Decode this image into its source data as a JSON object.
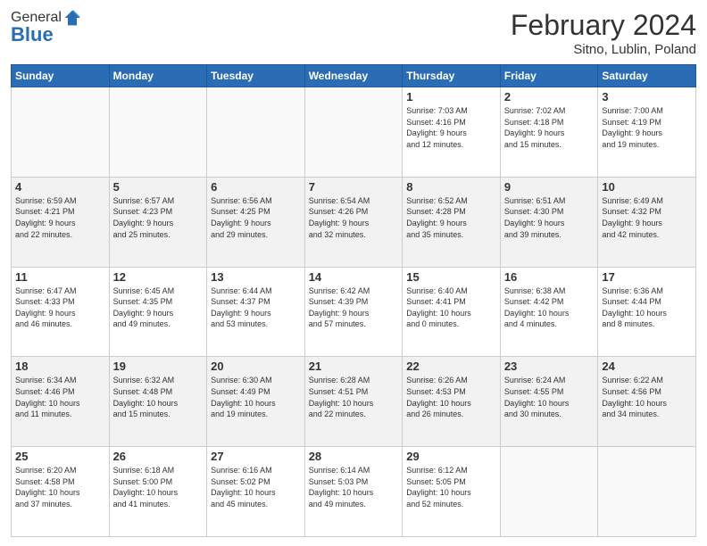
{
  "header": {
    "logo_general": "General",
    "logo_blue": "Blue",
    "month_title": "February 2024",
    "location": "Sitno, Lublin, Poland"
  },
  "days_of_week": [
    "Sunday",
    "Monday",
    "Tuesday",
    "Wednesday",
    "Thursday",
    "Friday",
    "Saturday"
  ],
  "weeks": [
    {
      "shade": false,
      "days": [
        {
          "num": "",
          "empty": true
        },
        {
          "num": "",
          "empty": true
        },
        {
          "num": "",
          "empty": true
        },
        {
          "num": "",
          "empty": true
        },
        {
          "num": "1",
          "info": "Sunrise: 7:03 AM\nSunset: 4:16 PM\nDaylight: 9 hours\nand 12 minutes."
        },
        {
          "num": "2",
          "info": "Sunrise: 7:02 AM\nSunset: 4:18 PM\nDaylight: 9 hours\nand 15 minutes."
        },
        {
          "num": "3",
          "info": "Sunrise: 7:00 AM\nSunset: 4:19 PM\nDaylight: 9 hours\nand 19 minutes."
        }
      ]
    },
    {
      "shade": true,
      "days": [
        {
          "num": "4",
          "info": "Sunrise: 6:59 AM\nSunset: 4:21 PM\nDaylight: 9 hours\nand 22 minutes."
        },
        {
          "num": "5",
          "info": "Sunrise: 6:57 AM\nSunset: 4:23 PM\nDaylight: 9 hours\nand 25 minutes."
        },
        {
          "num": "6",
          "info": "Sunrise: 6:56 AM\nSunset: 4:25 PM\nDaylight: 9 hours\nand 29 minutes."
        },
        {
          "num": "7",
          "info": "Sunrise: 6:54 AM\nSunset: 4:26 PM\nDaylight: 9 hours\nand 32 minutes."
        },
        {
          "num": "8",
          "info": "Sunrise: 6:52 AM\nSunset: 4:28 PM\nDaylight: 9 hours\nand 35 minutes."
        },
        {
          "num": "9",
          "info": "Sunrise: 6:51 AM\nSunset: 4:30 PM\nDaylight: 9 hours\nand 39 minutes."
        },
        {
          "num": "10",
          "info": "Sunrise: 6:49 AM\nSunset: 4:32 PM\nDaylight: 9 hours\nand 42 minutes."
        }
      ]
    },
    {
      "shade": false,
      "days": [
        {
          "num": "11",
          "info": "Sunrise: 6:47 AM\nSunset: 4:33 PM\nDaylight: 9 hours\nand 46 minutes."
        },
        {
          "num": "12",
          "info": "Sunrise: 6:45 AM\nSunset: 4:35 PM\nDaylight: 9 hours\nand 49 minutes."
        },
        {
          "num": "13",
          "info": "Sunrise: 6:44 AM\nSunset: 4:37 PM\nDaylight: 9 hours\nand 53 minutes."
        },
        {
          "num": "14",
          "info": "Sunrise: 6:42 AM\nSunset: 4:39 PM\nDaylight: 9 hours\nand 57 minutes."
        },
        {
          "num": "15",
          "info": "Sunrise: 6:40 AM\nSunset: 4:41 PM\nDaylight: 10 hours\nand 0 minutes."
        },
        {
          "num": "16",
          "info": "Sunrise: 6:38 AM\nSunset: 4:42 PM\nDaylight: 10 hours\nand 4 minutes."
        },
        {
          "num": "17",
          "info": "Sunrise: 6:36 AM\nSunset: 4:44 PM\nDaylight: 10 hours\nand 8 minutes."
        }
      ]
    },
    {
      "shade": true,
      "days": [
        {
          "num": "18",
          "info": "Sunrise: 6:34 AM\nSunset: 4:46 PM\nDaylight: 10 hours\nand 11 minutes."
        },
        {
          "num": "19",
          "info": "Sunrise: 6:32 AM\nSunset: 4:48 PM\nDaylight: 10 hours\nand 15 minutes."
        },
        {
          "num": "20",
          "info": "Sunrise: 6:30 AM\nSunset: 4:49 PM\nDaylight: 10 hours\nand 19 minutes."
        },
        {
          "num": "21",
          "info": "Sunrise: 6:28 AM\nSunset: 4:51 PM\nDaylight: 10 hours\nand 22 minutes."
        },
        {
          "num": "22",
          "info": "Sunrise: 6:26 AM\nSunset: 4:53 PM\nDaylight: 10 hours\nand 26 minutes."
        },
        {
          "num": "23",
          "info": "Sunrise: 6:24 AM\nSunset: 4:55 PM\nDaylight: 10 hours\nand 30 minutes."
        },
        {
          "num": "24",
          "info": "Sunrise: 6:22 AM\nSunset: 4:56 PM\nDaylight: 10 hours\nand 34 minutes."
        }
      ]
    },
    {
      "shade": false,
      "days": [
        {
          "num": "25",
          "info": "Sunrise: 6:20 AM\nSunset: 4:58 PM\nDaylight: 10 hours\nand 37 minutes."
        },
        {
          "num": "26",
          "info": "Sunrise: 6:18 AM\nSunset: 5:00 PM\nDaylight: 10 hours\nand 41 minutes."
        },
        {
          "num": "27",
          "info": "Sunrise: 6:16 AM\nSunset: 5:02 PM\nDaylight: 10 hours\nand 45 minutes."
        },
        {
          "num": "28",
          "info": "Sunrise: 6:14 AM\nSunset: 5:03 PM\nDaylight: 10 hours\nand 49 minutes."
        },
        {
          "num": "29",
          "info": "Sunrise: 6:12 AM\nSunset: 5:05 PM\nDaylight: 10 hours\nand 52 minutes."
        },
        {
          "num": "",
          "empty": true
        },
        {
          "num": "",
          "empty": true
        }
      ]
    }
  ]
}
